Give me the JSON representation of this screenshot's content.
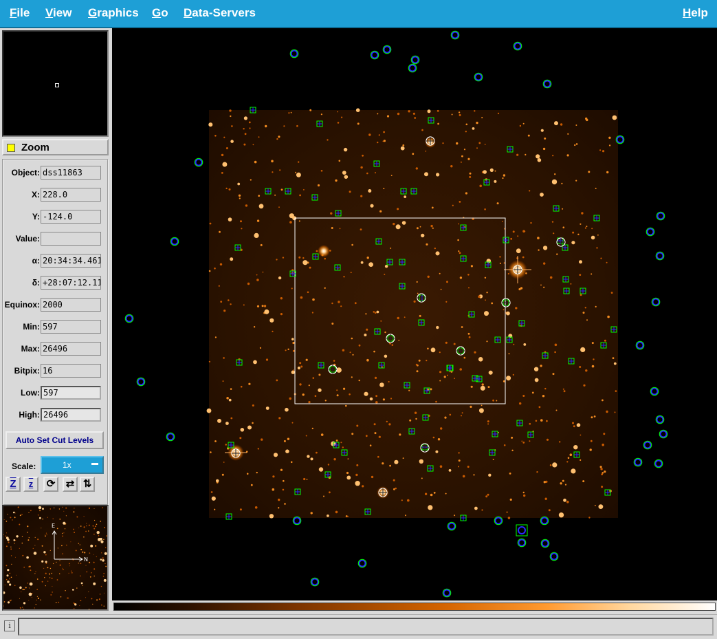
{
  "menu": {
    "file": {
      "first": "F",
      "rest": "ile"
    },
    "view": {
      "first": "V",
      "rest": "iew"
    },
    "graphics": {
      "first": "G",
      "rest": "raphics"
    },
    "go": {
      "first": "G",
      "rest": "o"
    },
    "data_servers": {
      "first": "D",
      "rest": "ata-Servers"
    },
    "help": {
      "first": "H",
      "rest": "elp"
    }
  },
  "zoom": {
    "label": "Zoom"
  },
  "info": {
    "object": {
      "label": "Object:",
      "value": "dss11863"
    },
    "x": {
      "label": "X:",
      "value": "228.0"
    },
    "y": {
      "label": "Y:",
      "value": "-124.0"
    },
    "value": {
      "label": "Value:",
      "value": ""
    },
    "alpha": {
      "label": "α:",
      "value": "20:34:34.461"
    },
    "delta": {
      "label": "δ:",
      "value": "+28:07:12.11"
    },
    "equinox": {
      "label": "Equinox:",
      "value": "2000"
    },
    "min": {
      "label": "Min:",
      "value": "597"
    },
    "max": {
      "label": "Max:",
      "value": "26496"
    },
    "bitpix": {
      "label": "Bitpix:",
      "value": "16"
    },
    "low": {
      "label": "Low:",
      "value": "597"
    },
    "high": {
      "label": "High:",
      "value": "26496"
    }
  },
  "auto_set": "Auto Set Cut Levels",
  "scale": {
    "label": "Scale:",
    "value": "1x"
  },
  "tools": {
    "zoom_in": "Z",
    "zoom_out": "z",
    "rotate": "⟳",
    "flip_x": "⇄",
    "flip_y": "⇅"
  },
  "compass": {
    "east": "E",
    "north": "N"
  },
  "status": {
    "icon": "i",
    "text": ""
  },
  "colors": {
    "menubar": "#1e9fd6",
    "catalog_circle": "#2a2aff",
    "catalog_box": "#00ff00"
  }
}
